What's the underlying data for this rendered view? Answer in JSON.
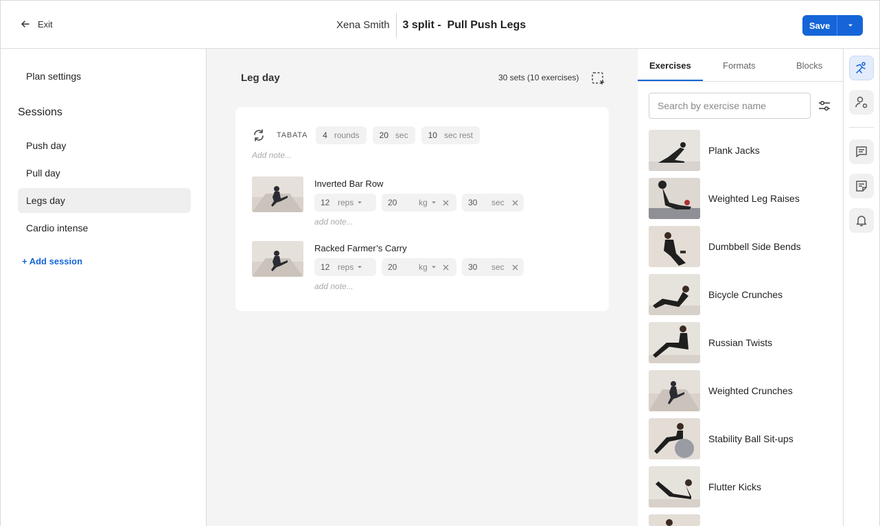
{
  "header": {
    "exit_label": "Exit",
    "client_name": "Xena Smith",
    "plan_name": "3 split -  Pull Push Legs",
    "save_label": "Save"
  },
  "sidebar": {
    "plan_settings": "Plan settings",
    "sessions_title": "Sessions",
    "sessions": [
      {
        "label": "Push day",
        "active": false
      },
      {
        "label": "Pull day",
        "active": false
      },
      {
        "label": "Legs day",
        "active": true
      },
      {
        "label": "Cardio intense",
        "active": false
      }
    ],
    "add_session": "+ Add session"
  },
  "main": {
    "day_title": "Leg day",
    "set_count": "30 sets (10 exercises)",
    "block": {
      "format": "TABATA",
      "rounds": {
        "value": "4",
        "unit": "rounds"
      },
      "work": {
        "value": "20",
        "unit": "sec"
      },
      "rest": {
        "value": "10",
        "unit": "sec rest"
      },
      "note_placeholder": "Add note..."
    },
    "exercises": [
      {
        "name": "Inverted Bar Row",
        "reps": {
          "value": "12",
          "unit": "reps"
        },
        "weight": {
          "value": "20",
          "unit": "kg"
        },
        "time": {
          "value": "30",
          "unit": "sec"
        },
        "note_placeholder": "add note..."
      },
      {
        "name": "Racked Farmer’s Carry",
        "reps": {
          "value": "12",
          "unit": "reps"
        },
        "weight": {
          "value": "20",
          "unit": "kg"
        },
        "time": {
          "value": "30",
          "unit": "sec"
        },
        "note_placeholder": "add note..."
      }
    ]
  },
  "panel": {
    "tabs": [
      "Exercises",
      "Formats",
      "Blocks"
    ],
    "active_tab": "Exercises",
    "search_placeholder": "Search by exercise name",
    "library": [
      "Plank Jacks",
      "Weighted Leg Raises",
      "Dumbbell Side Bends",
      "Bicycle Crunches",
      "Russian Twists",
      "Weighted Crunches",
      "Stability Ball Sit-ups",
      "Flutter Kicks"
    ]
  },
  "rail": {
    "icons": [
      "exercise-library-icon",
      "client-settings-icon",
      "chat-icon",
      "notes-icon",
      "bell-icon"
    ]
  },
  "colors": {
    "accent": "#1565d8",
    "main_bg": "#f4f4f4",
    "active_session_bg": "#efefef"
  }
}
